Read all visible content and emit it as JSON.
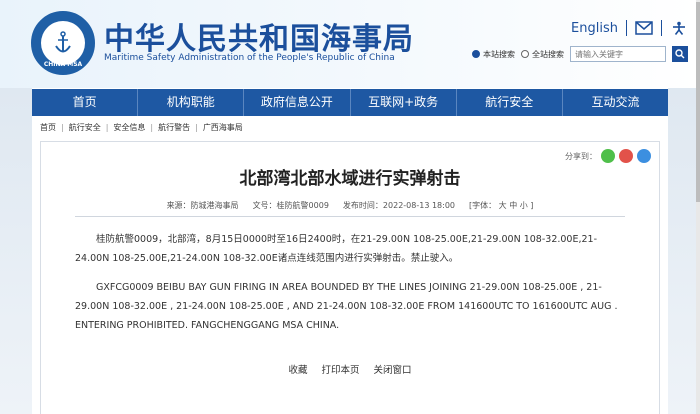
{
  "header": {
    "site_title": "中华人民共和国海事局",
    "site_subtitle": "Maritime Safety Administration of the People's Republic of China",
    "logo_text": "CHINA MSA",
    "lang": "English",
    "search": {
      "option_site": "本站搜索",
      "option_all": "全站搜索",
      "placeholder": "请输入关键字"
    }
  },
  "nav": {
    "items": [
      "首页",
      "机构职能",
      "政府信息公开",
      "互联网+政务",
      "航行安全",
      "互动交流"
    ]
  },
  "breadcrumb": [
    "首页",
    "航行安全",
    "安全信息",
    "航行警告",
    "广西海事局"
  ],
  "article": {
    "share_label": "分享到：",
    "title": "北部湾北部水域进行实弹射击",
    "source": "来源：防城港海事局",
    "doc_no": "文号：桂防航警0009",
    "date": "发布时间：2022-08-13 18:00",
    "font_size": "[字体： 大  中  小 ]",
    "para_cn": "桂防航警0009，北部湾，8月15日0000时至16日2400时，在21-29.00N 108-25.00E,21-29.00N 108-32.00E,21-24.00N 108-25.00E,21-24.00N 108-32.00E诸点连线范围内进行实弹射击。禁止驶入。",
    "para_en": "GXFCG0009 BEIBU BAY GUN FIRING IN AREA BOUNDED BY THE LINES JOINING 21-29.00N 108-25.00E , 21-29.00N 108-32.00E , 21-24.00N 108-25.00E , AND 21-24.00N 108-32.00E      FROM 141600UTC TO 161600UTC AUG . ENTERING PROHIBITED. FANGCHENGGANG MSA CHINA.",
    "actions": [
      "收藏",
      "打印本页",
      "关闭窗口"
    ]
  },
  "colors": {
    "brand_blue": "#1e58a3",
    "title_blue": "#1b4f9c"
  }
}
